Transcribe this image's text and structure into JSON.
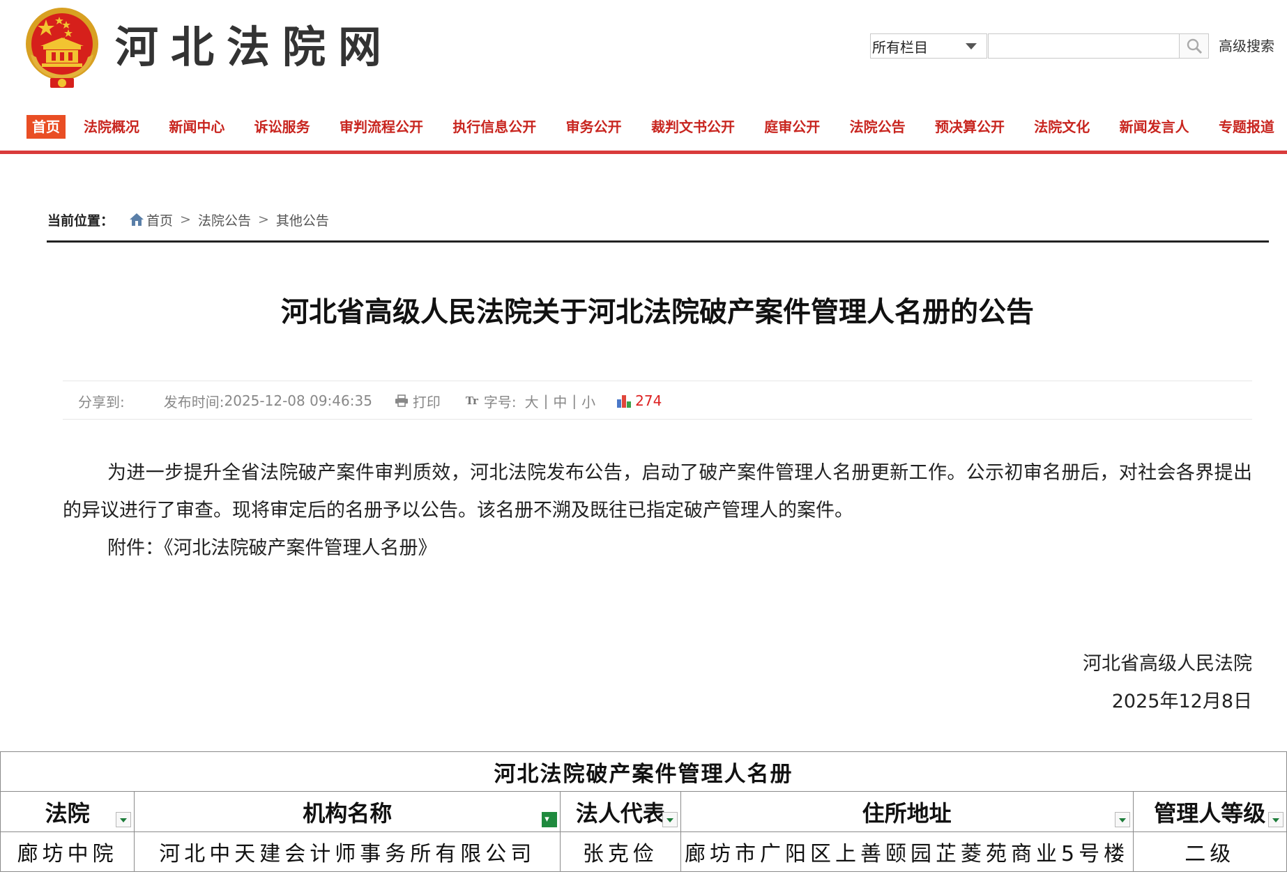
{
  "header": {
    "site_title": "河北法院网",
    "emblem_icon": "national-emblem-icon",
    "search": {
      "scope_selected": "所有栏目",
      "placeholder": "",
      "button_icon": "search-icon",
      "advanced_label": "高级搜索"
    }
  },
  "nav": {
    "items": [
      "首页",
      "法院概况",
      "新闻中心",
      "诉讼服务",
      "审判流程公开",
      "执行信息公开",
      "审务公开",
      "裁判文书公开",
      "庭审公开",
      "法院公告",
      "预决算公开",
      "法院文化",
      "新闻发言人",
      "专题报道"
    ],
    "active_index": 0,
    "accent_color": "#e94e24",
    "rule_color": "#d93b3b"
  },
  "breadcrumb": {
    "label": "当前位置：",
    "home_icon": "home-icon",
    "items": [
      "首页",
      "法院公告",
      "其他公告"
    ],
    "separator": ">"
  },
  "article": {
    "title": "河北省高级人民法院关于河北法院破产案件管理人名册的公告",
    "meta": {
      "share_label": "分享到:",
      "publish_label": "发布时间:",
      "publish_time": "2025-12-08 09:46:35",
      "print_icon": "print-icon",
      "print_label": "打印",
      "fontsize_icon": "font-size-icon",
      "fontsize_label": "字号:",
      "fontsize_options": [
        "大",
        "中",
        "小"
      ],
      "views_icon": "bar-chart-icon",
      "views": "274",
      "views_color": "#dd2222"
    },
    "paragraph1": "为进一步提升全省法院破产案件审判质效，河北法院发布公告，启动了破产案件管理人名册更新工作。公示初审名册后，对社会各界提出的异议进行了审查。现将审定后的名册予以公告。该名册不溯及既往已指定破产管理人的案件。",
    "attachment_label": "附件：",
    "attachment_link": "《河北法院破产案件管理人名册》",
    "signature_org": "河北省高级人民法院",
    "signature_date": "2025年12月8日"
  },
  "roster": {
    "caption": "河北法院破产案件管理人名册",
    "columns": [
      "法院",
      "机构名称",
      "法人代表",
      "住所地址",
      "管理人等级"
    ],
    "filter_active_column": 1,
    "rows": [
      [
        "廊坊中院",
        "河北中天建会计师事务所有限公司",
        "张克俭",
        "廊坊市广阳区上善颐园芷菱苑商业5号楼",
        "二级"
      ]
    ]
  }
}
